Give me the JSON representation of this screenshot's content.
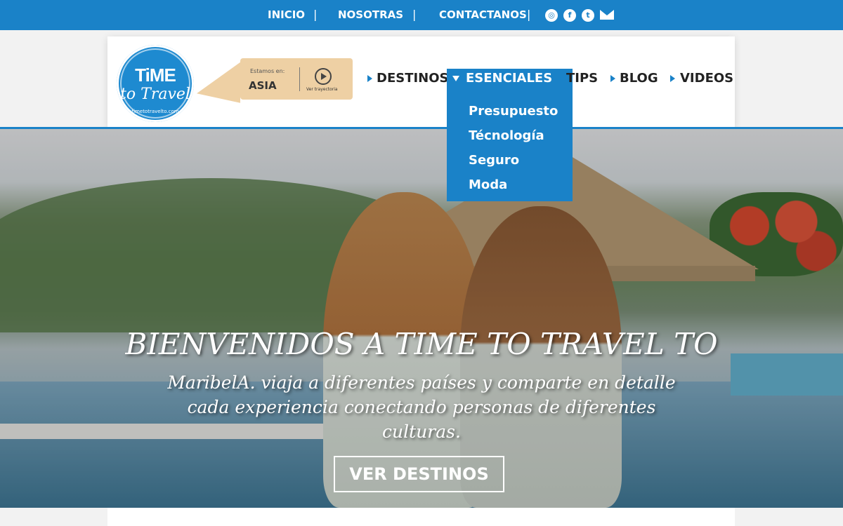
{
  "topbar": {
    "links": [
      "INICIO",
      "NOSOTRAS",
      "CONTACTANOS"
    ],
    "separator": "|",
    "social_icons": [
      "instagram-icon",
      "facebook-icon",
      "twitter-icon",
      "mail-icon"
    ]
  },
  "logo": {
    "line1": "TiME",
    "line2": "to Travel",
    "line3": "timetotravelto.com"
  },
  "location_badge": {
    "caption": "Estamos en:",
    "place": "ASIA",
    "link_label": "Ver trayectoria"
  },
  "nav": {
    "items": [
      "DESTINOS",
      "ESENCIALES",
      "TIPS",
      "BLOG",
      "VIDEOS"
    ],
    "active": "ESENCIALES"
  },
  "dropdown": {
    "items": [
      "Presupuesto",
      "Técnología",
      "Seguro",
      "Moda"
    ]
  },
  "hero": {
    "title": "BIENVENIDOS A TIME TO TRAVEL TO",
    "text": "MaribelA. viaja a diferentes países y comparte en detalle cada experiencia conectando personas de diferentes culturas.",
    "button": "VER DESTINOS"
  },
  "colors": {
    "brand_blue": "#1a82c8",
    "badge_tan": "#eed0a4"
  }
}
